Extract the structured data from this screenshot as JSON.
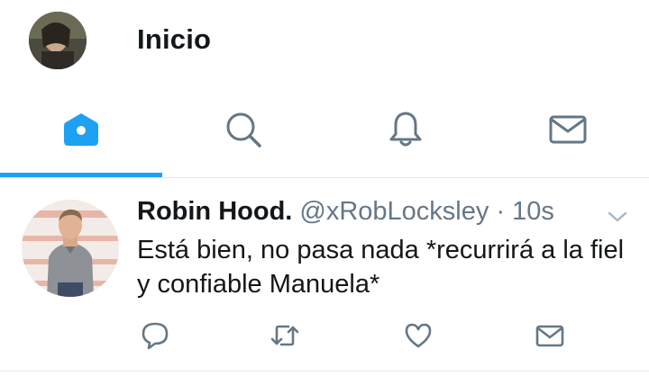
{
  "header": {
    "title": "Inicio",
    "avatar_icon": "profile-photo"
  },
  "tabs": [
    {
      "icon": "home-icon",
      "active": true
    },
    {
      "icon": "search-icon",
      "active": false
    },
    {
      "icon": "bell-icon",
      "active": false
    },
    {
      "icon": "mail-icon",
      "active": false
    }
  ],
  "colors": {
    "accent": "#1da1f2",
    "muted": "#657786",
    "text": "#14171a",
    "divider": "#e1e8ed"
  },
  "tweet": {
    "author_name": "Robin Hood.",
    "handle": "@xRobLocksley",
    "separator": "·",
    "time": "10s",
    "text": "Está bien, no pasa nada *recurrirá a la fiel y confiable Manuela*",
    "actions": [
      "reply-icon",
      "retweet-icon",
      "like-icon",
      "dm-icon"
    ]
  }
}
